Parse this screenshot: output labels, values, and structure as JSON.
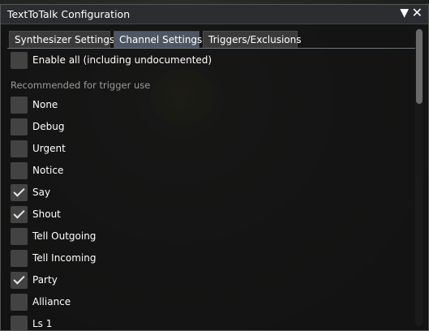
{
  "window": {
    "title": "TextToTalk Configuration",
    "collapse_icon": "triangle-down-icon",
    "close_icon": "close-icon"
  },
  "tabs": [
    {
      "label": "Synthesizer Settings",
      "active": false
    },
    {
      "label": "Channel Settings",
      "active": true
    },
    {
      "label": "Triggers/Exclusions",
      "active": false
    }
  ],
  "enable_all": {
    "label": "Enable all (including undocumented)",
    "checked": false
  },
  "section_label": "Recommended for trigger use",
  "channels": [
    {
      "label": "None",
      "checked": false
    },
    {
      "label": "Debug",
      "checked": false
    },
    {
      "label": "Urgent",
      "checked": false
    },
    {
      "label": "Notice",
      "checked": false
    },
    {
      "label": "Say",
      "checked": true
    },
    {
      "label": "Shout",
      "checked": true
    },
    {
      "label": "Tell Outgoing",
      "checked": false
    },
    {
      "label": "Tell Incoming",
      "checked": false
    },
    {
      "label": "Party",
      "checked": true
    },
    {
      "label": "Alliance",
      "checked": false
    },
    {
      "label": "Ls 1",
      "checked": false
    }
  ],
  "colors": {
    "active_tab": "#4f5663",
    "inactive_tab": "#3a3a3a",
    "checkbox_bg": "#434343",
    "checkmark": "#e8e8e8",
    "muted_text": "#9c9c9c"
  }
}
